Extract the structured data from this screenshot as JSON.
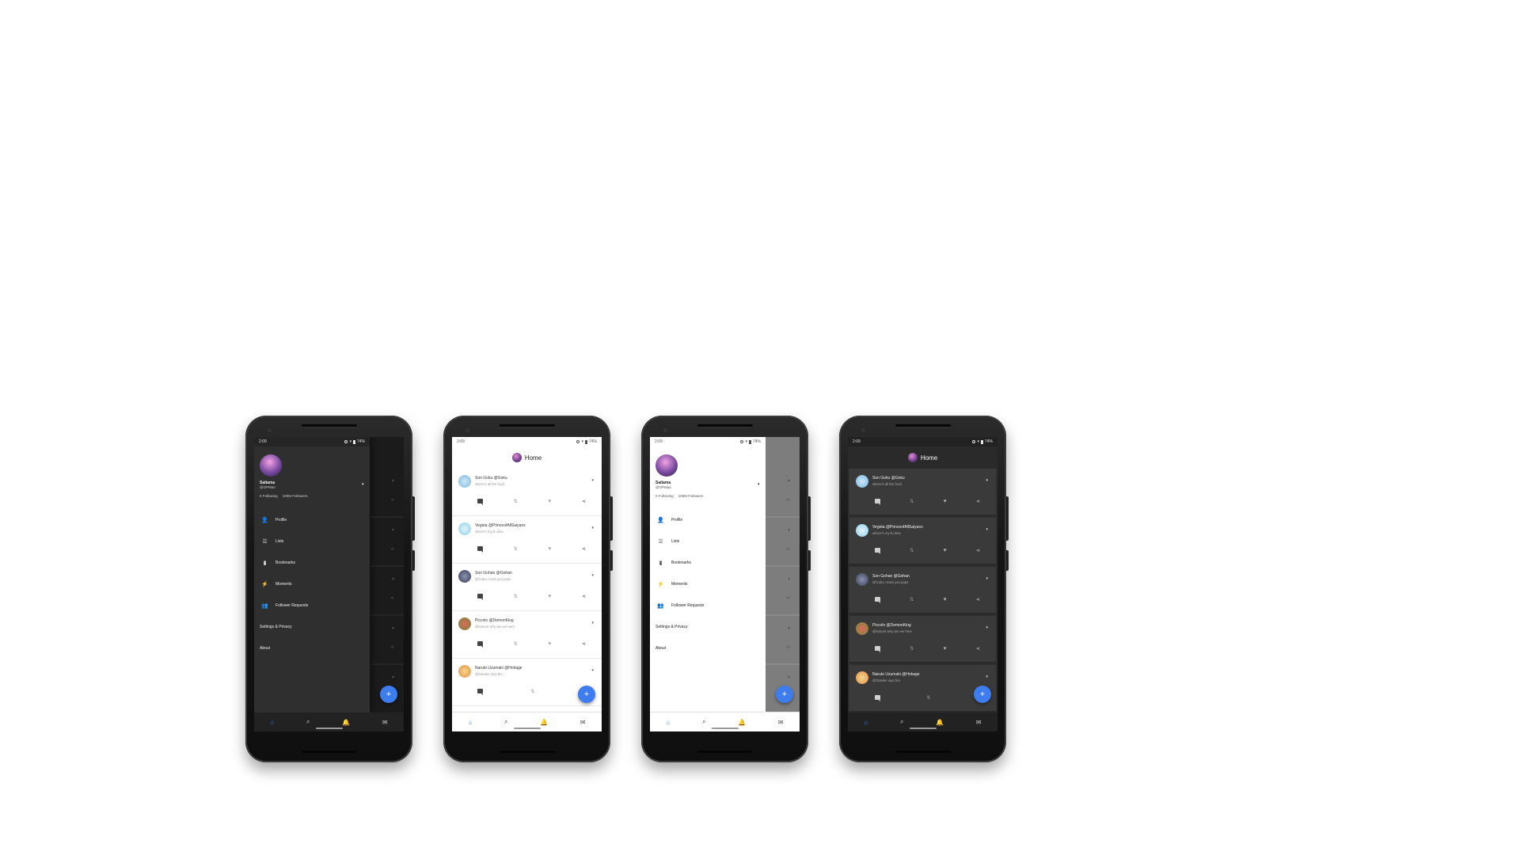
{
  "status": {
    "time": "2:09",
    "battery": "74%"
  },
  "home_title": "Home",
  "profile": {
    "name": "Saitama",
    "handle": "@OPMan",
    "following": "0 Following",
    "followers": "100M Followers"
  },
  "menu": {
    "items": [
      {
        "icon": "person-icon",
        "label": "Profile"
      },
      {
        "icon": "list-icon",
        "label": "Lists"
      },
      {
        "icon": "bookmark-icon",
        "label": "Bookmarks"
      },
      {
        "icon": "bolt-icon",
        "label": "Moments"
      },
      {
        "icon": "person-add-icon",
        "label": "Follower Requests"
      }
    ],
    "settings": "Settings & Privacy",
    "about": "About"
  },
  "tweets": [
    {
      "name": "Son Goku @Goku",
      "text": "where's all the food",
      "avatar_color": "#7ab8e0"
    },
    {
      "name": "Vegeta @PrinceofAllSaiyans",
      "text": "where's my b.ulma",
      "avatar_color": "#8fd0e6"
    },
    {
      "name": "Son Gohan @Gohan",
      "text": "@Goku i miss you pops",
      "avatar_color": "#3a3f55"
    },
    {
      "name": "Piccolo @DemonKing",
      "text": "@Naruto why are we here",
      "avatar_color": "#b8a040"
    },
    {
      "name": "Naruto Uzumaki @Hokage",
      "text": "@Sasuke wya bro",
      "avatar_color": "#e8b060"
    }
  ],
  "accent": "#3d7df0"
}
